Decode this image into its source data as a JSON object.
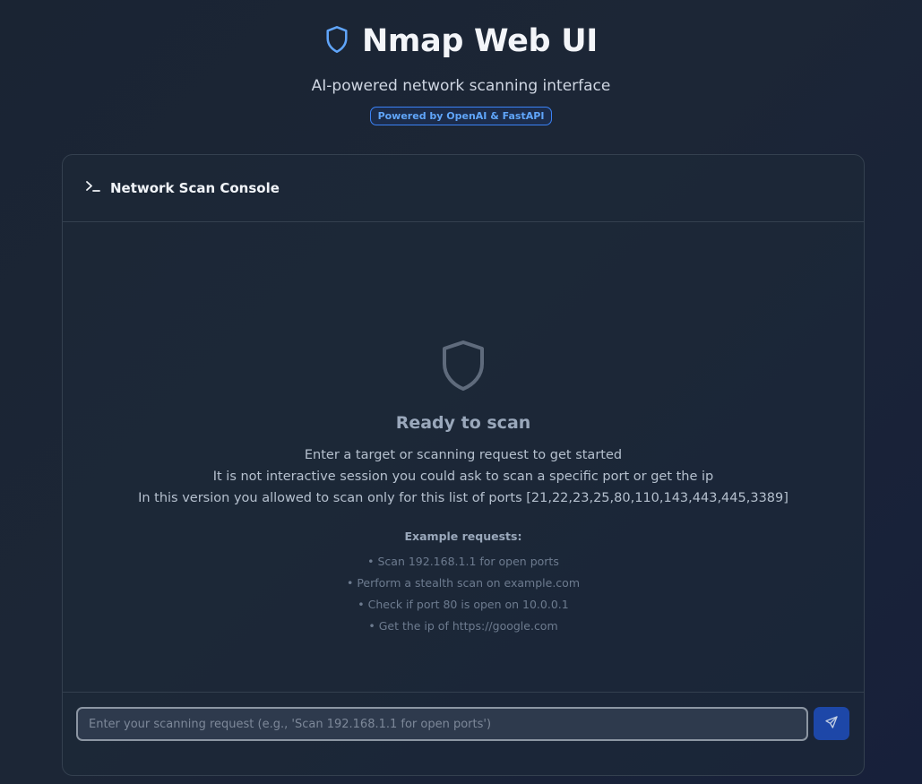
{
  "header": {
    "title": "Nmap Web UI",
    "subtitle": "AI-powered network scanning interface",
    "badge": "Powered by OpenAI & FastAPI",
    "icon": "shield-icon"
  },
  "console": {
    "title": "Network Scan Console",
    "icon": "terminal-icon",
    "empty_state": {
      "icon": "shield-icon",
      "heading": "Ready to scan",
      "lines": [
        "Enter a target or scanning request to get started",
        "It is not interactive session you could ask to scan a specific port or get the ip",
        "In this version you allowed to scan only for this list of ports [21,22,23,25,80,110,143,443,445,3389]"
      ],
      "examples_title": "Example requests:",
      "examples": [
        "• Scan 192.168.1.1 for open ports",
        "• Perform a stealth scan on example.com",
        "• Check if port 80 is open on 10.0.0.1",
        "• Get the ip of https://google.com"
      ]
    },
    "input": {
      "value": "",
      "placeholder": "Enter your scanning request (e.g., 'Scan 192.168.1.1 for open ports')"
    },
    "send_icon": "send-icon"
  },
  "colors": {
    "accent": "#3b82f6",
    "accent_light": "#60a5fa",
    "send_button": "#1d47a8",
    "background": "#1b2535"
  }
}
